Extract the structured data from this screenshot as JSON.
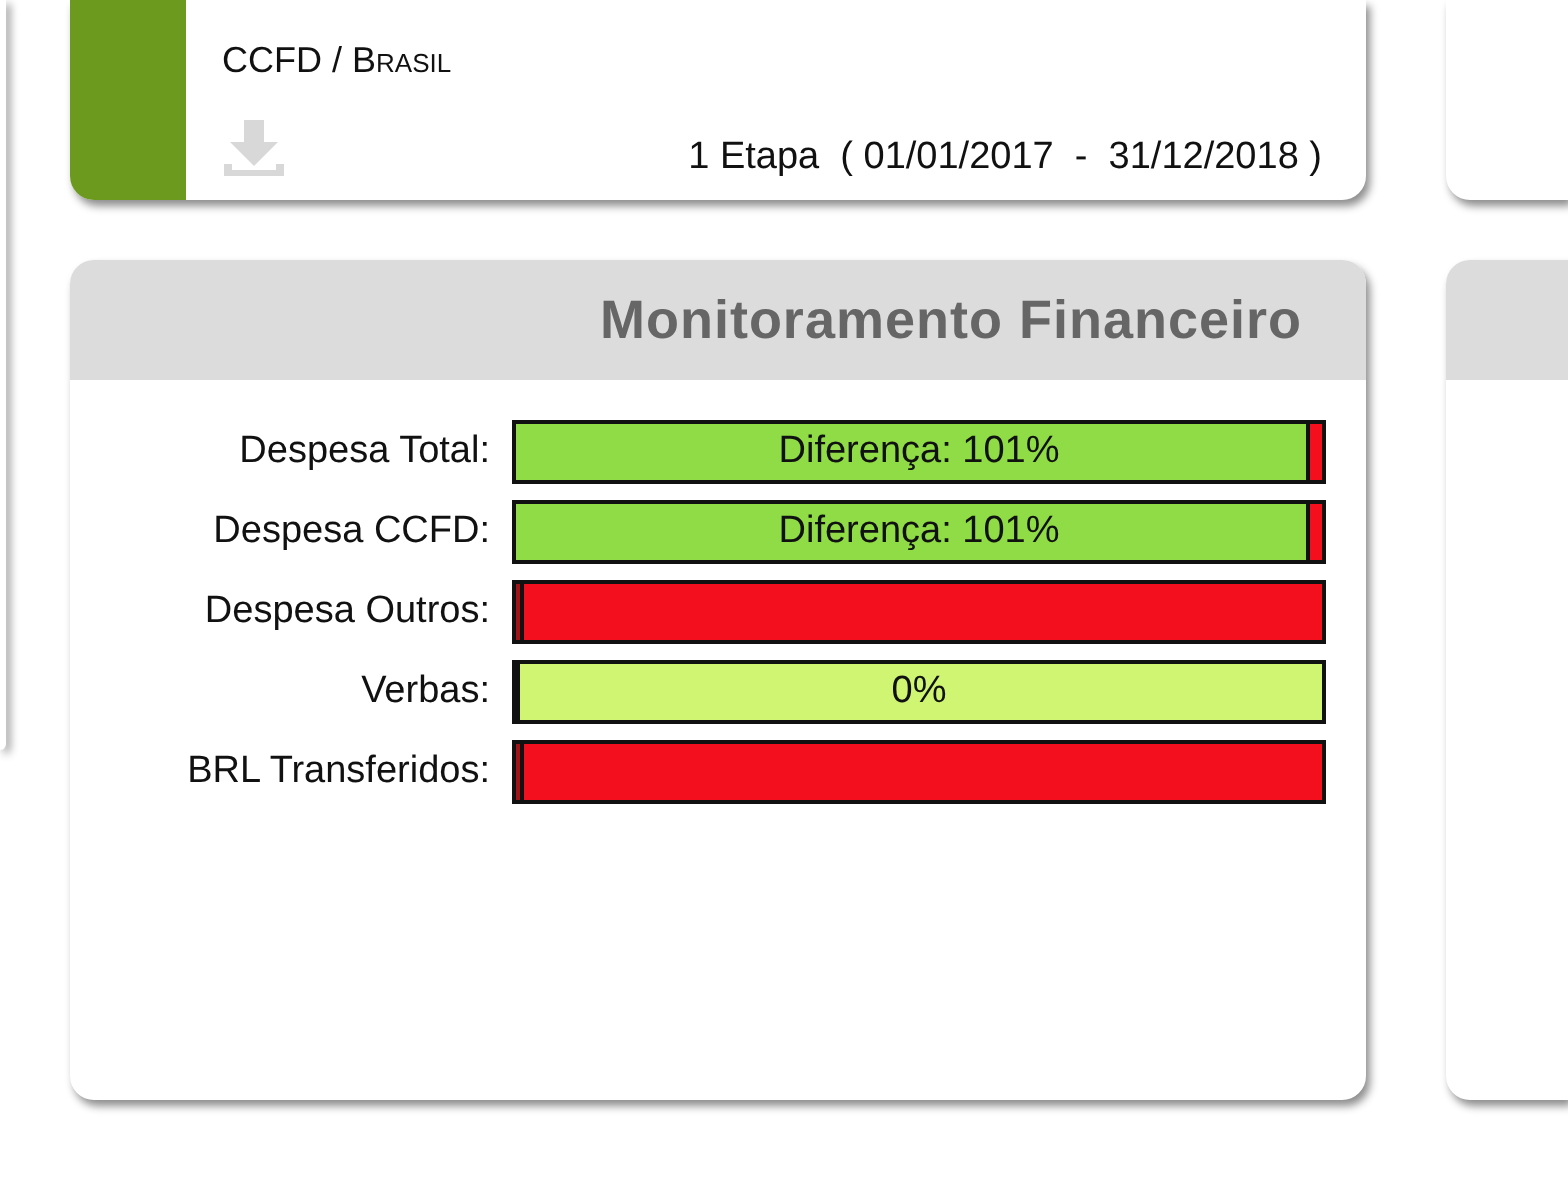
{
  "project_card": {
    "org": "CCFD /",
    "country": "Brasil",
    "period": "1 Etapa  ( 01/01/2017  -  31/12/2018 )"
  },
  "finance_panel": {
    "title": "Monitoramento Financeiro",
    "rows": [
      {
        "label": "Despesa Total:",
        "text": "Diferença: 101%",
        "level": 0.985,
        "kind": "exceeded"
      },
      {
        "label": "Despesa CCFD:",
        "text": "Diferença: 101%",
        "level": 0.985,
        "kind": "exceeded"
      },
      {
        "label": "Despesa Outros:",
        "level": 0.01,
        "kind": "short"
      },
      {
        "label": "Verbas:",
        "text": "0%",
        "level": 0,
        "kind": "empty"
      },
      {
        "label": "BRL Transferidos:",
        "level": 0.01,
        "kind": "short"
      }
    ]
  }
}
